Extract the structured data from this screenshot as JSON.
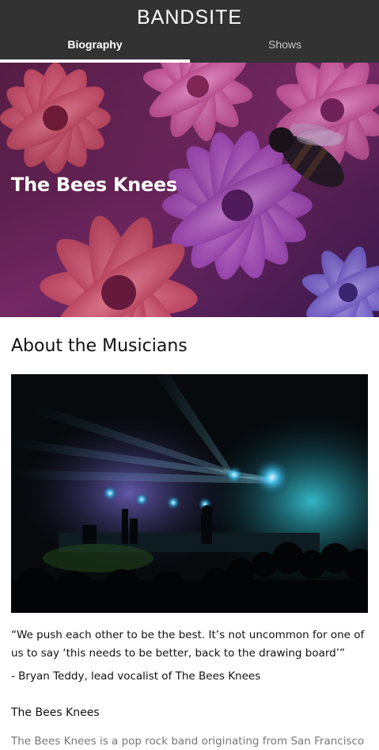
{
  "header": {
    "brand": "BANDSITE",
    "tabs": [
      {
        "label": "Biography",
        "active": true
      },
      {
        "label": "Shows",
        "active": false
      }
    ]
  },
  "hero": {
    "title": "The Bees Knees",
    "image": "pink and purple flowers with a bee"
  },
  "about": {
    "title": "About the Musicians",
    "image": "concert stage with blue lights and crowd",
    "quote": "“We push each other to be the best. It’s not uncommon for one of us to say ‘this needs to be better, back to the drawing board’”",
    "attribution": "- Bryan Teddy, lead vocalist of The Bees Knees",
    "subheading": "The Bees Knees",
    "body_partial": "The Bees Knees is a pop rock band originating from San Francisco"
  },
  "colors": {
    "header_bg": "#323232",
    "text": "#111111",
    "muted_text": "#777777",
    "hero_tint": "#b73aa8"
  }
}
